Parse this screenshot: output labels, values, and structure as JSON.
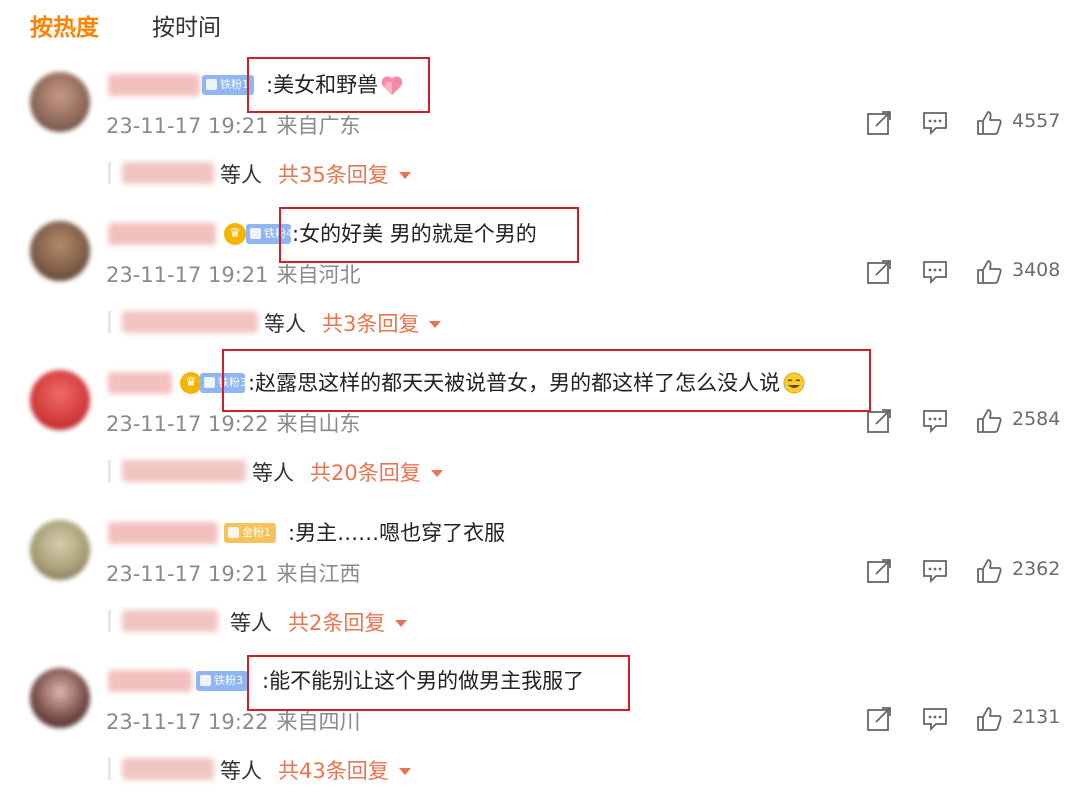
{
  "tabs": {
    "hot": "按热度",
    "time": "按时间"
  },
  "comments": [
    {
      "badge": "铁粉1",
      "text": ":美女和野兽",
      "emoji": "pink-heart-emoji",
      "time": "23-11-17 19:21",
      "location": "来自广东",
      "likes": "4557",
      "reply_suffix": "等人",
      "reply_count": "共35条回复"
    },
    {
      "badge": "铁粉4",
      "text": ":女的好美 男的就是个男的",
      "time": "23-11-17 19:21",
      "location": "来自河北",
      "likes": "3408",
      "reply_suffix": "等人",
      "reply_count": "共3条回复"
    },
    {
      "badge": "铁粉32",
      "text": ":赵露思这样的都天天被说普女，男的都这样了怎么没人说",
      "emoji": "laugh-cry-emoji",
      "time": "23-11-17 19:22",
      "location": "来自山东",
      "likes": "2584",
      "reply_suffix": "等人",
      "reply_count": "共20条回复"
    },
    {
      "badge": "金粉1",
      "text": ":男主……嗯也穿了衣服",
      "time": "23-11-17 19:21",
      "location": "来自江西",
      "likes": "2362",
      "reply_suffix": "等人",
      "reply_count": "共2条回复"
    },
    {
      "badge": "铁粉3",
      "text": ":能不能别让这个男的做男主我服了",
      "time": "23-11-17 19:22",
      "location": "来自四川",
      "likes": "2131",
      "reply_suffix": "等人",
      "reply_count": "共43条回复"
    }
  ],
  "colors": {
    "accent_orange": "#ff8200",
    "reply_orange": "#eb7350",
    "highlight_red": "#d21e2a",
    "fan_badge_blue": "#8fb5f3",
    "gold_badge": "#f6c35b"
  },
  "icons": [
    "share-icon",
    "comment-icon",
    "like-icon"
  ]
}
